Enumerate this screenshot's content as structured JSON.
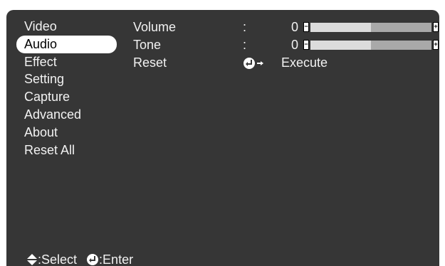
{
  "menu": {
    "items": [
      {
        "label": "Video",
        "active": false
      },
      {
        "label": "Audio",
        "active": true
      },
      {
        "label": "Effect",
        "active": false
      },
      {
        "label": "Setting",
        "active": false
      },
      {
        "label": "Capture",
        "active": false
      },
      {
        "label": "Advanced",
        "active": false
      },
      {
        "label": "About",
        "active": false
      },
      {
        "label": "Reset All",
        "active": false
      }
    ]
  },
  "settings": {
    "volume": {
      "label": "Volume",
      "colon": ":",
      "value": "0",
      "level": 0.5
    },
    "tone": {
      "label": "Tone",
      "colon": ":",
      "value": "0",
      "level": 0.5
    },
    "reset": {
      "label": "Reset",
      "action": "Execute",
      "icon": "enter-arrow-icon"
    }
  },
  "footer": {
    "select_icon": "up-down-arrow-icon",
    "select_label": ":Select",
    "enter_icon": "enter-icon",
    "enter_label": ":Enter"
  },
  "colors": {
    "background": "#363636",
    "text": "#f2f2f2",
    "highlight": "#ffffff",
    "slider_left": "#dcdcdc",
    "slider_right": "#a9a9a9"
  }
}
